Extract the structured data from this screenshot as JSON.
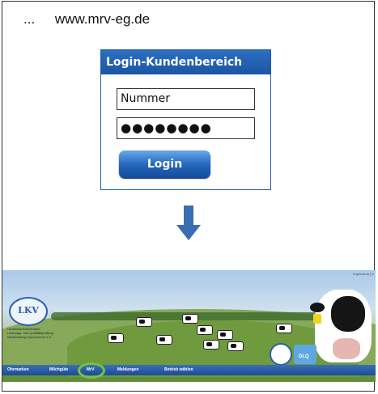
{
  "header": {
    "dots": "...",
    "url": "www.mrv-eg.de"
  },
  "login": {
    "title": "Login-Kundenbereich",
    "username_value": "Nummer",
    "password_value": "●●●●●●●●",
    "button_label": "Login"
  },
  "website": {
    "impressum": "Impressum | K",
    "logo_text": "LKV",
    "org_text": "Landeskontrollverband Leistungs- und Qualitätsprüfung Mecklenburg-Vorpommern e.V.",
    "nav": [
      "Ohrmarken",
      "Milchgüte",
      "MrV",
      "Meldungen",
      "Betrieb wählen"
    ],
    "seal_text": "DLQ"
  },
  "colors": {
    "login_header": "#1f5fb0",
    "arrow": "#3b6db4",
    "highlight": "#7bc241",
    "nav_bar": "#2a5ca4"
  }
}
